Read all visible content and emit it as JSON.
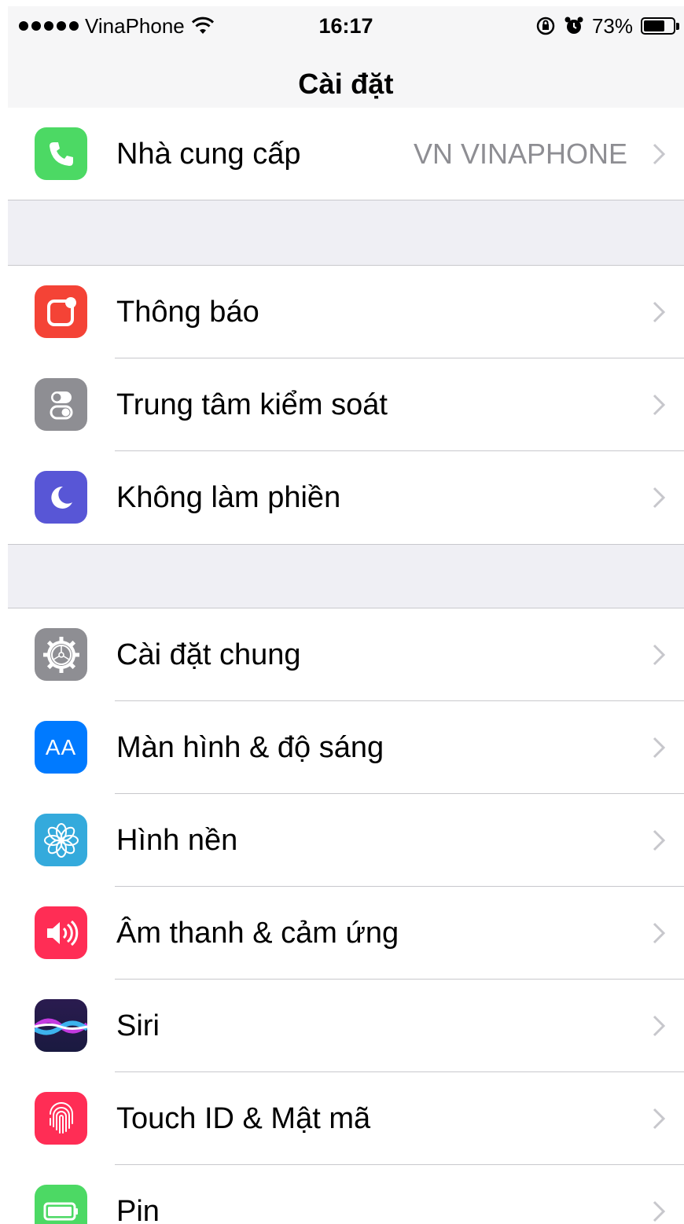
{
  "status_bar": {
    "carrier": "VinaPhone",
    "time": "16:17",
    "battery": "73%",
    "battery_level": 0.73
  },
  "nav": {
    "title": "Cài đặt"
  },
  "groups": [
    {
      "items": [
        {
          "label": "Nhà cung cấp",
          "detail": "VN VINAPHONE",
          "icon": "phone-icon",
          "color": "#4cd964"
        }
      ]
    },
    {
      "items": [
        {
          "label": "Thông báo",
          "icon": "notifications-icon",
          "color": "#f44336"
        },
        {
          "label": "Trung tâm kiểm soát",
          "icon": "control-center-icon",
          "color": "#8e8e93"
        },
        {
          "label": "Không làm phiền",
          "icon": "moon-icon",
          "color": "#5856d6"
        }
      ]
    },
    {
      "items": [
        {
          "label": "Cài đặt chung",
          "icon": "gear-icon",
          "color": "#8e8e93"
        },
        {
          "label": "Màn hình & độ sáng",
          "icon": "display-brightness-icon",
          "glyph": "AA",
          "color": "#007aff"
        },
        {
          "label": "Hình nền",
          "icon": "wallpaper-flower-icon",
          "color": "#34aadc"
        },
        {
          "label": "Âm thanh & cảm ứng",
          "icon": "speaker-icon",
          "color": "#ff2d55"
        },
        {
          "label": "Siri",
          "icon": "siri-icon",
          "color": "#1a1a40"
        },
        {
          "label": "Touch ID & Mật mã",
          "icon": "fingerprint-icon",
          "color": "#ff2d55"
        },
        {
          "label": "Pin",
          "icon": "battery-icon",
          "color": "#4cd964"
        }
      ]
    }
  ]
}
